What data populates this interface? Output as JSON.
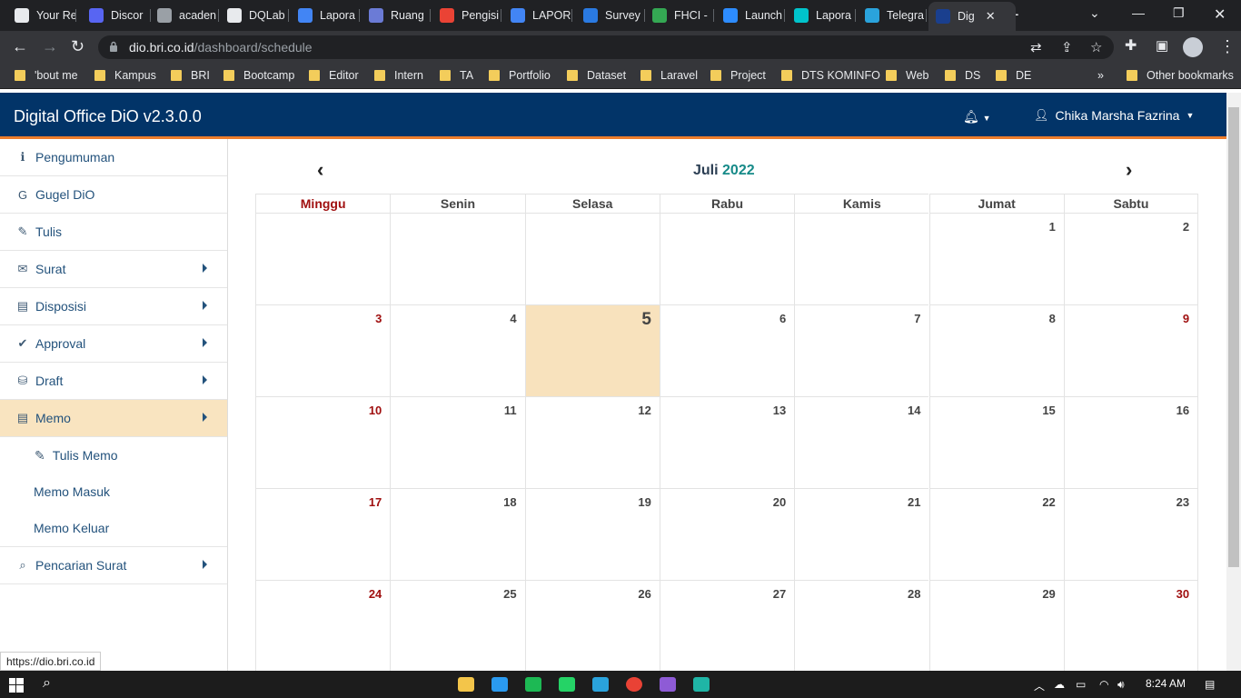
{
  "browser": {
    "tabs": [
      {
        "label": "Your Re",
        "icon": "github-icon",
        "color": "#e8eaed"
      },
      {
        "label": "Discor",
        "icon": "discord-icon",
        "color": "#5865f2"
      },
      {
        "label": "acaden",
        "icon": "dphi-icon",
        "color": "#9aa0a6"
      },
      {
        "label": "DQLab",
        "icon": "github-icon",
        "color": "#e8eaed"
      },
      {
        "label": "Lapora",
        "icon": "docs-icon",
        "color": "#4285f4"
      },
      {
        "label": "Ruang",
        "icon": "ruang-icon",
        "color": "#6b7bd6"
      },
      {
        "label": "Pengisi",
        "icon": "gmail-icon",
        "color": "#ea4335"
      },
      {
        "label": "LAPOR",
        "icon": "docs-icon",
        "color": "#4285f4"
      },
      {
        "label": "Survey",
        "icon": "survey-icon",
        "color": "#2a7ae2"
      },
      {
        "label": "FHCI -",
        "icon": "drive-icon",
        "color": "#34a853"
      },
      {
        "label": "Launch",
        "icon": "zoom-icon",
        "color": "#2d8cff"
      },
      {
        "label": "Lapora",
        "icon": "canva-icon",
        "color": "#00c4cc"
      },
      {
        "label": "Telegra",
        "icon": "telegram-icon",
        "color": "#2aa3dc"
      },
      {
        "label": "Dig",
        "icon": "dio-icon",
        "color": "#1a3f8e",
        "active": true
      }
    ],
    "url_host": "dio.bri.co.id",
    "url_path": "/dashboard/schedule",
    "bookmarks": [
      "'bout me",
      "Kampus",
      "BRI",
      "Bootcamp",
      "Editor",
      "Intern",
      "TA",
      "Portfolio",
      "Dataset",
      "Laravel",
      "Project",
      "DTS KOMINFO",
      "Web",
      "DS",
      "DE"
    ],
    "more_bookmarks": "»",
    "other_bookmarks": "Other bookmarks",
    "new_tab": "+",
    "status_url": "https://dio.bri.co.id"
  },
  "app": {
    "brand": "Digital Office DiO v2.3.0.0",
    "user_name": "Chika Marsha Fazrina",
    "sidebar": [
      {
        "label": "Pengumuman",
        "icon": "info-icon",
        "glyph": "ℹ",
        "arrow": false
      },
      {
        "label": "Gugel DiO",
        "icon": "google-icon",
        "glyph": "G",
        "arrow": false
      },
      {
        "label": "Tulis",
        "icon": "pencil-icon",
        "glyph": "✎",
        "arrow": false
      },
      {
        "label": "Surat",
        "icon": "envelope-icon",
        "glyph": "✉",
        "arrow": true
      },
      {
        "label": "Disposisi",
        "icon": "file-icon",
        "glyph": "▤",
        "arrow": true
      },
      {
        "label": "Approval",
        "icon": "check-icon",
        "glyph": "✔",
        "arrow": true
      },
      {
        "label": "Draft",
        "icon": "draft-icon",
        "glyph": "⛁",
        "arrow": true
      },
      {
        "label": "Memo",
        "icon": "memo-icon",
        "glyph": "▤",
        "arrow": true,
        "active": true
      }
    ],
    "memo_sub": [
      {
        "label": "Tulis Memo",
        "icon": "pencil-icon",
        "glyph": "✎"
      },
      {
        "label": "Memo Masuk"
      },
      {
        "label": "Memo Keluar"
      }
    ],
    "pencarian": {
      "label": "Pencarian Surat",
      "icon": "search-icon",
      "glyph": "⌕"
    },
    "calendar": {
      "prev": "‹",
      "next": "›",
      "month": "Juli",
      "year": "2022",
      "days": [
        "Minggu",
        "Senin",
        "Selasa",
        "Rabu",
        "Kamis",
        "Jumat",
        "Sabtu"
      ],
      "weeks": [
        [
          "",
          "",
          "",
          "",
          "",
          "1",
          "2"
        ],
        [
          "3",
          "4",
          "5",
          "6",
          "7",
          "8",
          "9"
        ],
        [
          "10",
          "11",
          "12",
          "13",
          "14",
          "15",
          "16"
        ],
        [
          "17",
          "18",
          "19",
          "20",
          "21",
          "22",
          "23"
        ],
        [
          "24",
          "25",
          "26",
          "27",
          "28",
          "29",
          "30"
        ]
      ],
      "today": "5"
    }
  },
  "taskbar": {
    "time": "8:24 AM",
    "apps": [
      {
        "icon": "explorer-icon",
        "color": "#f3c54a"
      },
      {
        "icon": "vscode-icon",
        "color": "#2a9af0"
      },
      {
        "icon": "spotify-icon",
        "color": "#1db954"
      },
      {
        "icon": "whatsapp-icon",
        "color": "#25d366"
      },
      {
        "icon": "telegram-icon",
        "color": "#2aa3dc"
      },
      {
        "icon": "chrome-icon",
        "color": "#e94235"
      },
      {
        "icon": "github-desktop-icon",
        "color": "#8e5bd6"
      },
      {
        "icon": "edge-icon",
        "color": "#1fb5a6"
      }
    ]
  }
}
